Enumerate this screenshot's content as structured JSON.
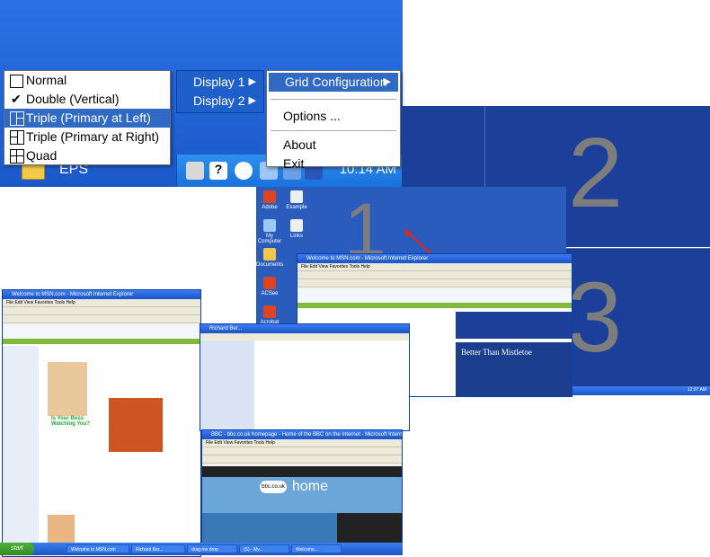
{
  "taskbar_top": {
    "start_item_label": "EPS",
    "clock": "10:14 AM"
  },
  "layout_menu": {
    "items": [
      {
        "label": "Normal",
        "state": "unchecked"
      },
      {
        "label": "Double (Vertical)",
        "state": "checked"
      },
      {
        "label": "Triple (Primary at Left)",
        "state": "highlighted"
      },
      {
        "label": "Triple (Primary at Right)",
        "state": "normal"
      },
      {
        "label": "Quad",
        "state": "normal"
      }
    ]
  },
  "display_menu": {
    "items": [
      {
        "label": "Display 1",
        "has_submenu": true
      },
      {
        "label": "Display 2",
        "has_submenu": true
      }
    ]
  },
  "options_menu": {
    "grid_label": "Grid Configuration",
    "options_label": "Options ...",
    "about_label": "About",
    "exit_label": "Exit"
  },
  "display_numbers": {
    "one": "1",
    "two": "2",
    "three": "3"
  },
  "windows": {
    "ie_top_title": "Welcome to MSN.com - Microsoft Internet Explorer",
    "ie_left_title": "Welcome to MSN.com - Microsoft Internet Explorer",
    "ie_bbc_title": "BBC - bbc.co.uk homepage - Home of the BBC on the Internet - Microsoft Internet Explorer",
    "bbc_home": "home",
    "bbc_logo": "bbc.co.uk",
    "christmas_text": "Better Than Mistletoe",
    "boss_text": "Is Your Boss Watching You?"
  },
  "taskbar_bottom": {
    "start_label": "start",
    "items": [
      "Welcome to MSN.com",
      "Richard Ber...",
      "drag me drop",
      "(S) - My...",
      "Welcome..."
    ]
  },
  "colors": {
    "desktop_blue": "#1c3f9a",
    "menu_highlight": "#316ac5",
    "taskbar_blue": "#1b58c9",
    "big_number_gray": "#7d7d7d"
  }
}
